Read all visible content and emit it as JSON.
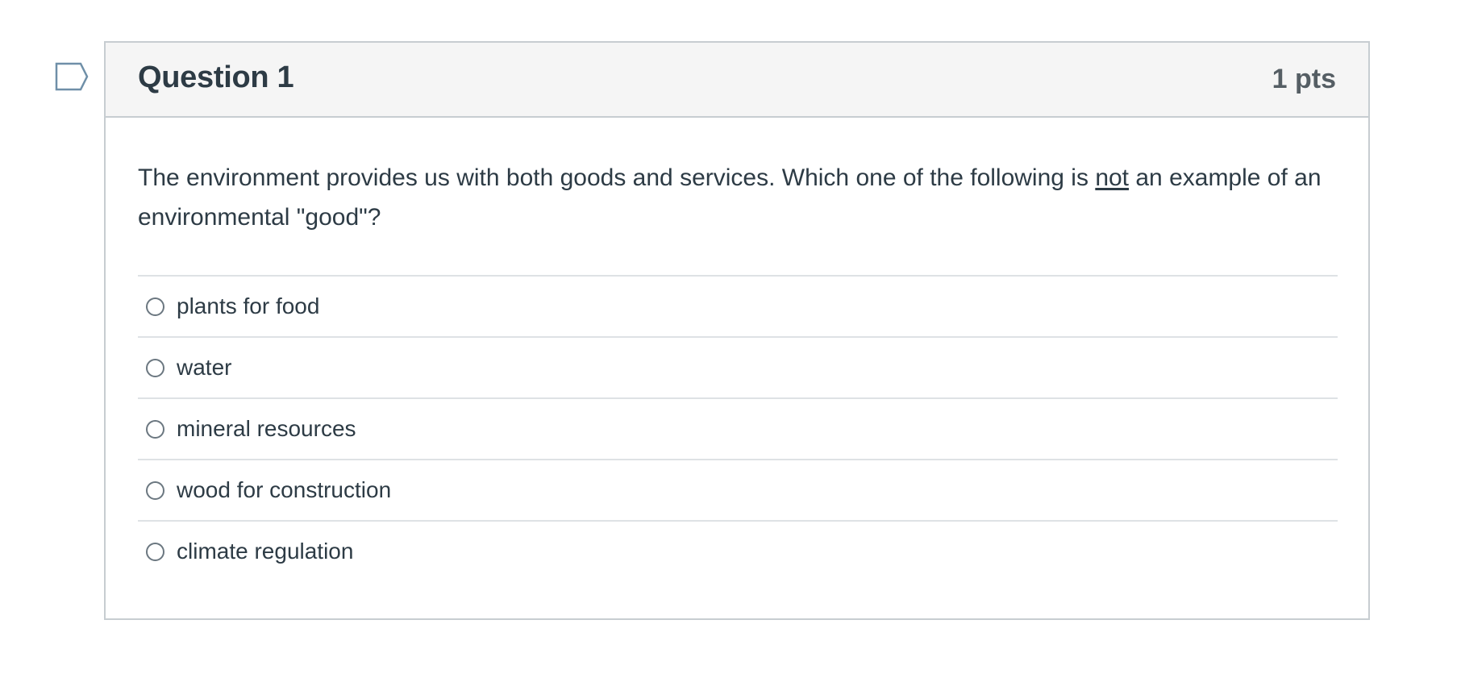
{
  "question": {
    "title": "Question 1",
    "points": "1 pts",
    "text_before": "The environment provides us with both goods and services. Which one of the following is ",
    "text_emphasis": "not",
    "text_after": " an example of an environmental \"good\"?",
    "answers": [
      {
        "label": "plants for food",
        "selected": false
      },
      {
        "label": "water",
        "selected": false
      },
      {
        "label": "mineral resources",
        "selected": false
      },
      {
        "label": "wood for construction",
        "selected": false
      },
      {
        "label": "climate regulation",
        "selected": false
      }
    ]
  },
  "icons": {
    "flag": "flag-question-icon"
  },
  "colors": {
    "text": "#2d3b45",
    "header_bg": "#f5f5f5",
    "border": "#c7cdd1",
    "flag_stroke": "#6f8fa8"
  }
}
